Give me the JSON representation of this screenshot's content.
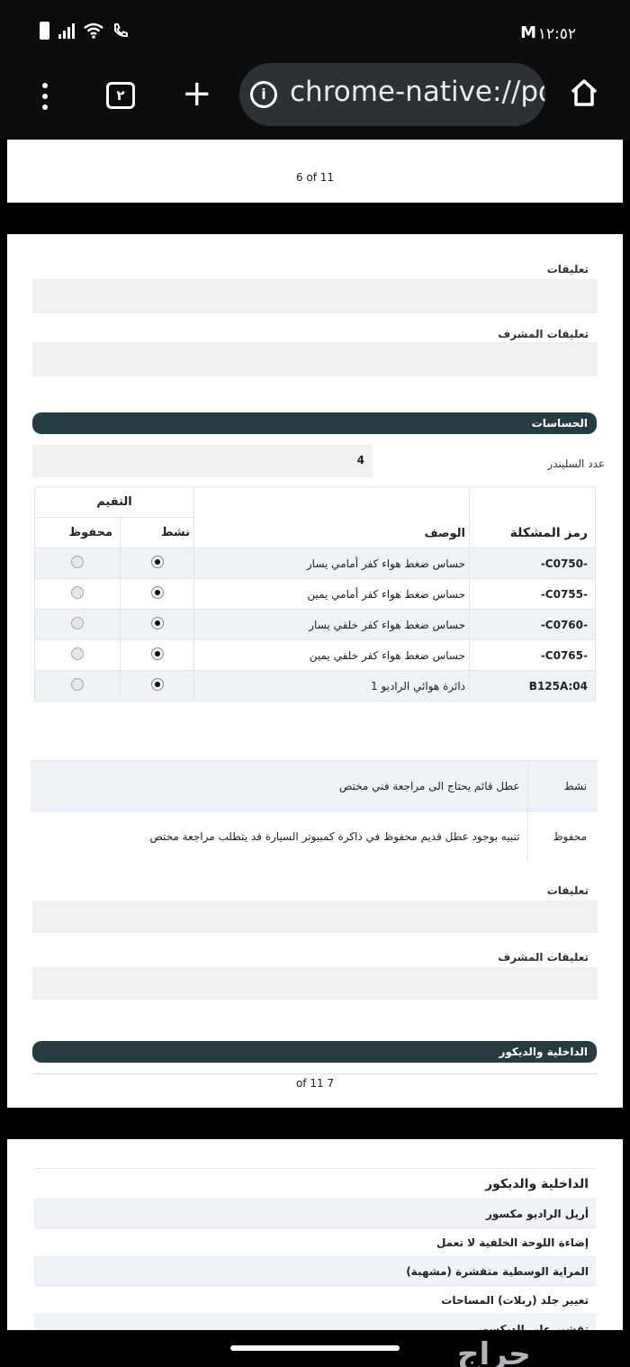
{
  "status_bar": {
    "time": "١٢:٥٢",
    "mail_icon": "M"
  },
  "browser": {
    "tab_count": "٢",
    "url": "chrome-native://pd"
  },
  "page6": {
    "page_number": "6 of 11",
    "comments_label": "تعليقات",
    "supervisor_comments_label": "تعليقات المشرف",
    "sensors_title": "الحساسات",
    "cylinders_label": "عدد السليندر",
    "cylinders_value": "4",
    "table": {
      "rating_header": "التقيم",
      "code_header": "رمز المشكلة",
      "desc_header": "الوصف",
      "active_header": "نشط",
      "stored_header": "محفوظ",
      "rows": [
        {
          "code": "-C0750-",
          "desc": "حساس ضغط هواء كفر أمامي يسار"
        },
        {
          "code": "-C0755-",
          "desc": "حساس ضغط هواء كفر أمامي يمين"
        },
        {
          "code": "-C0760-",
          "desc": "حساس ضغط هواء كفر خلفي يسار"
        },
        {
          "code": "-C0765-",
          "desc": "حساس ضغط هواء كفر خلفي يمين"
        },
        {
          "code": "B125A:04",
          "desc": "دائرة هوائي الراديو 1"
        }
      ]
    },
    "legend": [
      {
        "label": "نشط",
        "text": "عطل قائم يحتاج الى مراجعة فني مختص"
      },
      {
        "label": "محفوظ",
        "text": "تنبيه بوجود عطل قديم محفوظ في ذاكرة كمبيوتر السيارة قد يتطلب مراجعة مختص"
      }
    ],
    "comments_label_2": "تعليقات",
    "supervisor_comments_label_2": "تعليقات المشرف",
    "interior_title": "الداخلية والديكور",
    "page_number_bottom": "7 of 11"
  },
  "page7": {
    "heading": "الداخلية والديكور",
    "items": [
      "أريل الراديو مكسور",
      "إضاءة اللوحة الخلفية لا تعمل",
      "المراية الوسطية متقشرة (مشهبة)",
      "تغيير جلد (ربلات) المساحات",
      "تقشير على الديكسور"
    ]
  },
  "watermark": "حراج"
}
